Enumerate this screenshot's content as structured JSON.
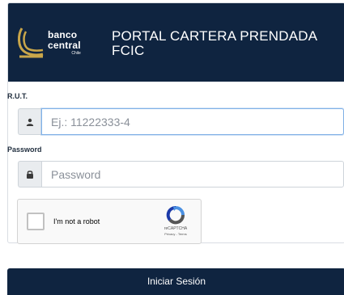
{
  "header": {
    "logo_line1": "banco",
    "logo_line2": "central",
    "logo_line3": "Chile",
    "title": "PORTAL CARTERA PRENDADA FCIC"
  },
  "form": {
    "rut": {
      "label": "R.U.T.",
      "placeholder": "Ej.: 11222333-4",
      "value": "",
      "icon": "user-icon"
    },
    "password": {
      "label": "Password",
      "placeholder": "Password",
      "value": "",
      "icon": "lock-icon"
    },
    "recaptcha": {
      "checkbox_label": "I'm not a robot",
      "brand": "reCAPTCHA",
      "terms": "Privacy - Terms",
      "checked": false
    },
    "submit_label": "Iniciar Sesión"
  },
  "colors": {
    "header_bg": "#0f2440",
    "button_bg": "#0f2440",
    "logo_accent": "#c9a64a"
  }
}
